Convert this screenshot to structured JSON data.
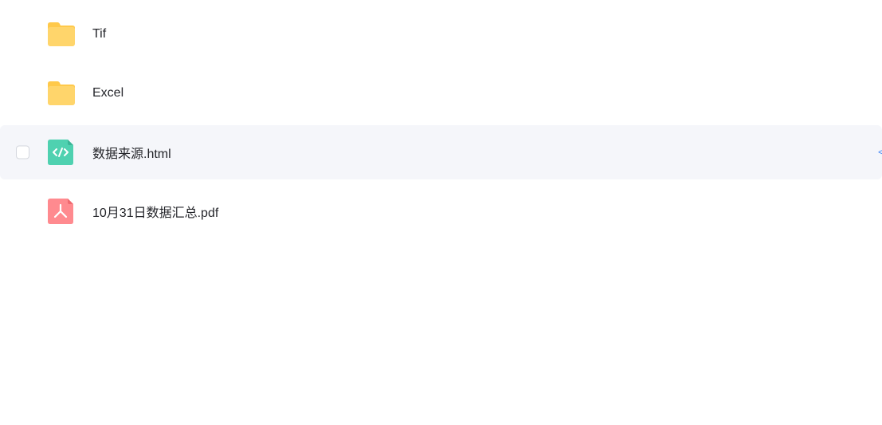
{
  "files": [
    {
      "name": "Tif",
      "type": "folder",
      "icon": "folder-icon"
    },
    {
      "name": "Excel",
      "type": "folder",
      "icon": "folder-icon"
    },
    {
      "name": "数据来源.html",
      "type": "html",
      "icon": "html-file-icon",
      "hovered": true
    },
    {
      "name": "10月31日数据汇总.pdf",
      "type": "pdf",
      "icon": "pdf-file-icon"
    }
  ],
  "colors": {
    "folder": "#ffd56b",
    "folder_back": "#ffc94a",
    "html": "#4fd1b0",
    "pdf": "#ff8a8f",
    "hover_bg": "#f5f6fa",
    "accent": "#4c8cf5"
  }
}
